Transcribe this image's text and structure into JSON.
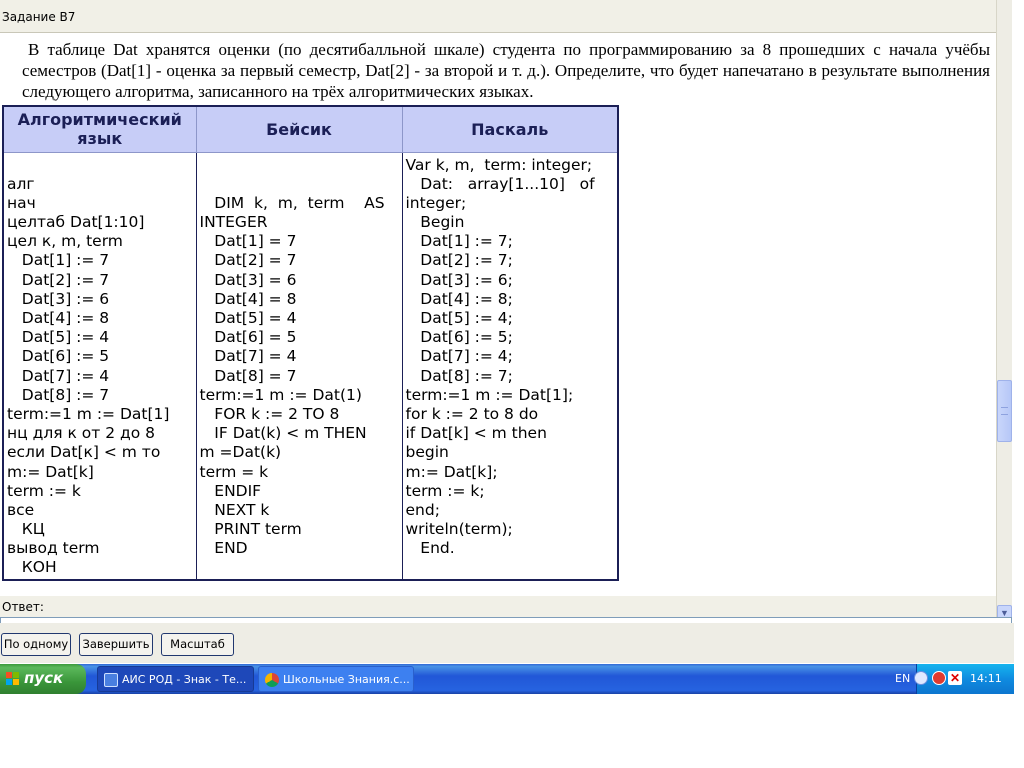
{
  "window": {
    "title": "Задание В7"
  },
  "question": {
    "text": "В таблице Dat хранятся оценки (по десятибалльной шкале) студента по программированию за 8 прошедших с начала учёбы семестров (Dat[1] - оценка за первый семестр, Dat[2] - за второй и т. д.). Определите, что будет напечатано в результате выполнения следующего алгоритма, записанного на трёх алгоритмических языках."
  },
  "table": {
    "headers": [
      "Алгоритмический язык",
      "Бейсик",
      "Паскаль"
    ],
    "algorithmic": [
      "",
      "алг",
      "нач",
      "целтаб Dat[1:10]",
      "цел к, m, term",
      "   Dat[1] := 7",
      "   Dat[2] := 7",
      "   Dat[3] := 6",
      "   Dat[4] := 8",
      "   Dat[5] := 4",
      "   Dat[6] := 5",
      "   Dat[7] := 4",
      "   Dat[8] := 7",
      "term:=1 m := Dat[1]",
      "нц для к от 2 до 8",
      "если Dat[к] < m то",
      "m:= Dat[k]",
      "term := k",
      "все",
      "   КЦ",
      "вывод term",
      "   КОН"
    ],
    "basic": [
      "",
      "",
      "   DIM  k,  m,  term    AS",
      "INTEGER",
      "   Dat[1] = 7",
      "   Dat[2] = 7",
      "   Dat[3] = 6",
      "   Dat[4] = 8",
      "   Dat[5] = 4",
      "   Dat[6] = 5",
      "   Dat[7] = 4",
      "   Dat[8] = 7",
      "term:=1 m := Dat(1)",
      "   FOR k := 2 TO 8",
      "   IF Dat(k) < m THEN",
      "m =Dat(k)",
      "term = k",
      "   ENDIF",
      "   NEXT k",
      "   PRINT term",
      "   END"
    ],
    "pascal": [
      "Var k, m,  term: integer;",
      "   Dat:   array[1...10]   of",
      "integer;",
      "   Begin",
      "   Dat[1] := 7;",
      "   Dat[2] := 7;",
      "   Dat[3] := 6;",
      "   Dat[4] := 8;",
      "   Dat[5] := 4;",
      "   Dat[6] := 5;",
      "   Dat[7] := 4;",
      "   Dat[8] := 7;",
      "term:=1 m := Dat[1];",
      "for k := 2 to 8 do",
      "if Dat[k] < m then",
      "begin",
      "m:= Dat[k];",
      "term := k;",
      "end;",
      "writeln(term);",
      "   End."
    ]
  },
  "answer": {
    "label": "Ответ:"
  },
  "buttons": {
    "one_by_one": "По одному",
    "finish": "Завершить",
    "scale": "Масштаб"
  },
  "taskbar": {
    "start_label": "пуск",
    "items": [
      {
        "label": "АИС РОД - Знак - Те...",
        "icon": "ais-app-icon"
      },
      {
        "label": "Школьные Знания.с...",
        "icon": "chrome-icon"
      }
    ],
    "lang": "EN",
    "time": "14:11"
  },
  "colors": {
    "header_bg": "#c7cdf7",
    "taskbar_blue": "#2157d7",
    "start_green": "#3a963a"
  }
}
